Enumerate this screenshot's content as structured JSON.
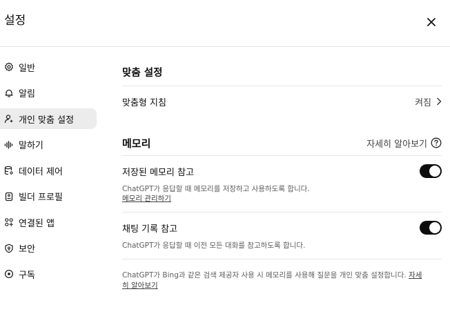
{
  "header": {
    "title": "설정"
  },
  "sidebar": {
    "items": [
      {
        "label": "일반",
        "icon": "gear-icon"
      },
      {
        "label": "알림",
        "icon": "bell-icon"
      },
      {
        "label": "개인 맞춤 설정",
        "icon": "person-sparkle-icon"
      },
      {
        "label": "말하기",
        "icon": "waveform-icon"
      },
      {
        "label": "데이터 제어",
        "icon": "database-icon"
      },
      {
        "label": "빌더 프로필",
        "icon": "id-card-icon"
      },
      {
        "label": "연결된 앱",
        "icon": "apps-grid-icon"
      },
      {
        "label": "보안",
        "icon": "shield-icon"
      },
      {
        "label": "구독",
        "icon": "subscription-icon"
      }
    ],
    "active_index": 2
  },
  "personalization": {
    "title": "맞춤 설정",
    "custom_instructions": {
      "label": "맞춤형 지침",
      "value": "켜짐"
    }
  },
  "memory": {
    "title": "메모리",
    "learn_more": "자세히 알아보기",
    "saved_memory": {
      "label": "저장된 메모리 참고",
      "enabled": true,
      "description": "ChatGPT가 응답할 때 메모리를 저장하고 사용하도록 합니다.",
      "manage_link": "메모리 관리하기"
    },
    "chat_history": {
      "label": "채팅 기록 참고",
      "enabled": true,
      "description": "ChatGPT가 응답할 때 이전 모든 대화를 참고하도록 합니다."
    },
    "footer": {
      "text": "ChatGPT가 Bing과 같은 검색 제공자 사용 시 메모리를 사용해 질문을 개인 맞춤 설정합니다.",
      "link": "자세히 알아보기"
    }
  }
}
